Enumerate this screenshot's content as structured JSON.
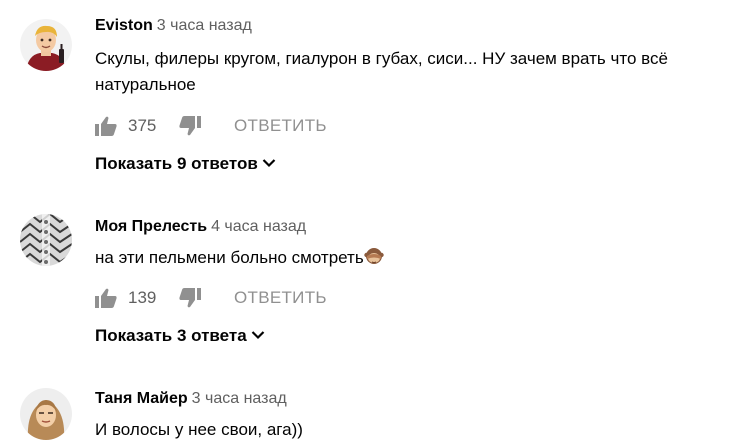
{
  "comments": [
    {
      "author": "Eviston",
      "time": "3 часа назад",
      "text": "Скулы, филеры кругом, гиалурон в губах, сиси... НУ зачем врать что всё натуральное",
      "likes": "375",
      "reply_label": "ОТВЕТИТЬ",
      "replies_label": "Показать 9 ответов",
      "avatar_icon": "cartoon-man-avatar-icon"
    },
    {
      "author": "Моя Прелесть",
      "time": "4 часа назад",
      "text": "на эти пельмени больно смотреть",
      "emoji_icon": "see-no-evil-monkey-icon",
      "likes": "139",
      "reply_label": "ОТВЕТИТЬ",
      "replies_label": "Показать 3 ответа",
      "avatar_icon": "pattern-avatar-icon"
    },
    {
      "author": "Таня Майер",
      "time": "3 часа назад",
      "text": "И волосы у нее свои, ага))",
      "avatar_icon": "cartoon-woman-avatar-icon"
    }
  ],
  "colors": {
    "text": "#030303",
    "secondary": "#606060",
    "reply": "#909090"
  }
}
